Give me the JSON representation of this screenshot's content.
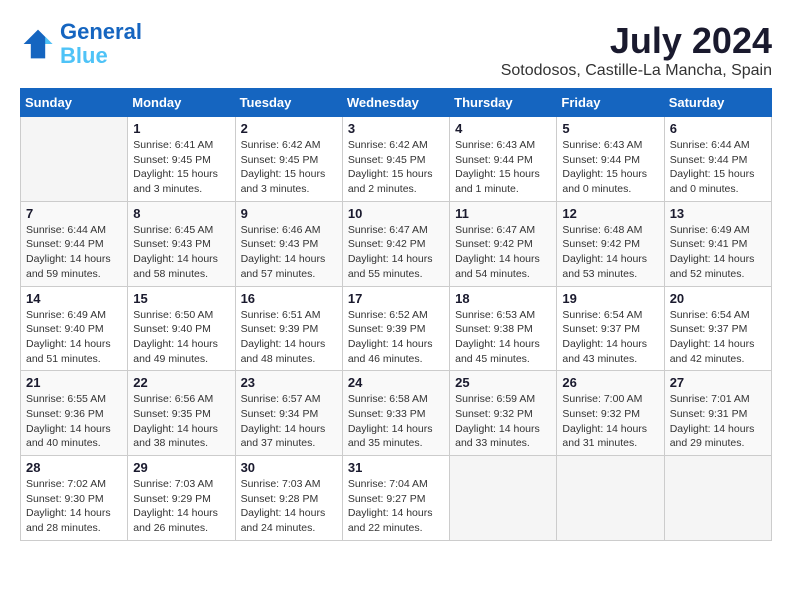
{
  "header": {
    "logo_line1": "General",
    "logo_line2": "Blue",
    "month_year": "July 2024",
    "location": "Sotodosos, Castille-La Mancha, Spain"
  },
  "days_of_week": [
    "Sunday",
    "Monday",
    "Tuesday",
    "Wednesday",
    "Thursday",
    "Friday",
    "Saturday"
  ],
  "weeks": [
    [
      {
        "day": "",
        "sunrise": "",
        "sunset": "",
        "daylight": ""
      },
      {
        "day": "1",
        "sunrise": "Sunrise: 6:41 AM",
        "sunset": "Sunset: 9:45 PM",
        "daylight": "Daylight: 15 hours and 3 minutes."
      },
      {
        "day": "2",
        "sunrise": "Sunrise: 6:42 AM",
        "sunset": "Sunset: 9:45 PM",
        "daylight": "Daylight: 15 hours and 3 minutes."
      },
      {
        "day": "3",
        "sunrise": "Sunrise: 6:42 AM",
        "sunset": "Sunset: 9:45 PM",
        "daylight": "Daylight: 15 hours and 2 minutes."
      },
      {
        "day": "4",
        "sunrise": "Sunrise: 6:43 AM",
        "sunset": "Sunset: 9:44 PM",
        "daylight": "Daylight: 15 hours and 1 minute."
      },
      {
        "day": "5",
        "sunrise": "Sunrise: 6:43 AM",
        "sunset": "Sunset: 9:44 PM",
        "daylight": "Daylight: 15 hours and 0 minutes."
      },
      {
        "day": "6",
        "sunrise": "Sunrise: 6:44 AM",
        "sunset": "Sunset: 9:44 PM",
        "daylight": "Daylight: 15 hours and 0 minutes."
      }
    ],
    [
      {
        "day": "7",
        "sunrise": "Sunrise: 6:44 AM",
        "sunset": "Sunset: 9:44 PM",
        "daylight": "Daylight: 14 hours and 59 minutes."
      },
      {
        "day": "8",
        "sunrise": "Sunrise: 6:45 AM",
        "sunset": "Sunset: 9:43 PM",
        "daylight": "Daylight: 14 hours and 58 minutes."
      },
      {
        "day": "9",
        "sunrise": "Sunrise: 6:46 AM",
        "sunset": "Sunset: 9:43 PM",
        "daylight": "Daylight: 14 hours and 57 minutes."
      },
      {
        "day": "10",
        "sunrise": "Sunrise: 6:47 AM",
        "sunset": "Sunset: 9:42 PM",
        "daylight": "Daylight: 14 hours and 55 minutes."
      },
      {
        "day": "11",
        "sunrise": "Sunrise: 6:47 AM",
        "sunset": "Sunset: 9:42 PM",
        "daylight": "Daylight: 14 hours and 54 minutes."
      },
      {
        "day": "12",
        "sunrise": "Sunrise: 6:48 AM",
        "sunset": "Sunset: 9:42 PM",
        "daylight": "Daylight: 14 hours and 53 minutes."
      },
      {
        "day": "13",
        "sunrise": "Sunrise: 6:49 AM",
        "sunset": "Sunset: 9:41 PM",
        "daylight": "Daylight: 14 hours and 52 minutes."
      }
    ],
    [
      {
        "day": "14",
        "sunrise": "Sunrise: 6:49 AM",
        "sunset": "Sunset: 9:40 PM",
        "daylight": "Daylight: 14 hours and 51 minutes."
      },
      {
        "day": "15",
        "sunrise": "Sunrise: 6:50 AM",
        "sunset": "Sunset: 9:40 PM",
        "daylight": "Daylight: 14 hours and 49 minutes."
      },
      {
        "day": "16",
        "sunrise": "Sunrise: 6:51 AM",
        "sunset": "Sunset: 9:39 PM",
        "daylight": "Daylight: 14 hours and 48 minutes."
      },
      {
        "day": "17",
        "sunrise": "Sunrise: 6:52 AM",
        "sunset": "Sunset: 9:39 PM",
        "daylight": "Daylight: 14 hours and 46 minutes."
      },
      {
        "day": "18",
        "sunrise": "Sunrise: 6:53 AM",
        "sunset": "Sunset: 9:38 PM",
        "daylight": "Daylight: 14 hours and 45 minutes."
      },
      {
        "day": "19",
        "sunrise": "Sunrise: 6:54 AM",
        "sunset": "Sunset: 9:37 PM",
        "daylight": "Daylight: 14 hours and 43 minutes."
      },
      {
        "day": "20",
        "sunrise": "Sunrise: 6:54 AM",
        "sunset": "Sunset: 9:37 PM",
        "daylight": "Daylight: 14 hours and 42 minutes."
      }
    ],
    [
      {
        "day": "21",
        "sunrise": "Sunrise: 6:55 AM",
        "sunset": "Sunset: 9:36 PM",
        "daylight": "Daylight: 14 hours and 40 minutes."
      },
      {
        "day": "22",
        "sunrise": "Sunrise: 6:56 AM",
        "sunset": "Sunset: 9:35 PM",
        "daylight": "Daylight: 14 hours and 38 minutes."
      },
      {
        "day": "23",
        "sunrise": "Sunrise: 6:57 AM",
        "sunset": "Sunset: 9:34 PM",
        "daylight": "Daylight: 14 hours and 37 minutes."
      },
      {
        "day": "24",
        "sunrise": "Sunrise: 6:58 AM",
        "sunset": "Sunset: 9:33 PM",
        "daylight": "Daylight: 14 hours and 35 minutes."
      },
      {
        "day": "25",
        "sunrise": "Sunrise: 6:59 AM",
        "sunset": "Sunset: 9:32 PM",
        "daylight": "Daylight: 14 hours and 33 minutes."
      },
      {
        "day": "26",
        "sunrise": "Sunrise: 7:00 AM",
        "sunset": "Sunset: 9:32 PM",
        "daylight": "Daylight: 14 hours and 31 minutes."
      },
      {
        "day": "27",
        "sunrise": "Sunrise: 7:01 AM",
        "sunset": "Sunset: 9:31 PM",
        "daylight": "Daylight: 14 hours and 29 minutes."
      }
    ],
    [
      {
        "day": "28",
        "sunrise": "Sunrise: 7:02 AM",
        "sunset": "Sunset: 9:30 PM",
        "daylight": "Daylight: 14 hours and 28 minutes."
      },
      {
        "day": "29",
        "sunrise": "Sunrise: 7:03 AM",
        "sunset": "Sunset: 9:29 PM",
        "daylight": "Daylight: 14 hours and 26 minutes."
      },
      {
        "day": "30",
        "sunrise": "Sunrise: 7:03 AM",
        "sunset": "Sunset: 9:28 PM",
        "daylight": "Daylight: 14 hours and 24 minutes."
      },
      {
        "day": "31",
        "sunrise": "Sunrise: 7:04 AM",
        "sunset": "Sunset: 9:27 PM",
        "daylight": "Daylight: 14 hours and 22 minutes."
      },
      {
        "day": "",
        "sunrise": "",
        "sunset": "",
        "daylight": ""
      },
      {
        "day": "",
        "sunrise": "",
        "sunset": "",
        "daylight": ""
      },
      {
        "day": "",
        "sunrise": "",
        "sunset": "",
        "daylight": ""
      }
    ]
  ]
}
